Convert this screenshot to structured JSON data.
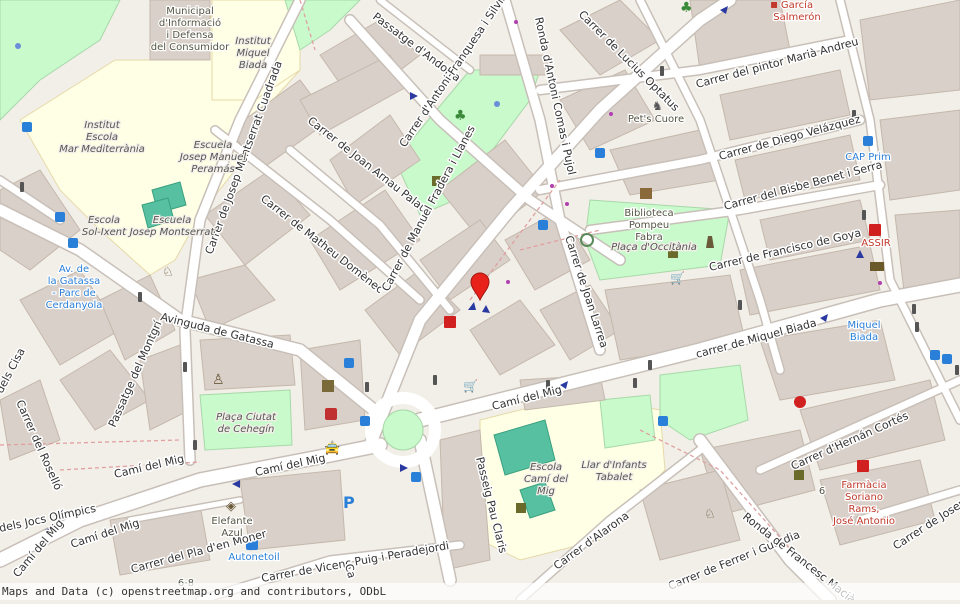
{
  "colors": {
    "background": "#f2efe9",
    "building": "#d9d0c9",
    "school": "#ffffe5",
    "park": "#c8facc",
    "road": "#ffffff",
    "road_outline": "#bbbbbb",
    "marker": "#e8221a",
    "transit_blue": "#2a7fd8",
    "health_red": "#c0392b"
  },
  "streets": {
    "andorra": "Passatge d'Andorra",
    "franquesa": "Carrer d'Antoni Franquesa i Silvia",
    "comas": "Ronda d'Antoni Comas i Pujol",
    "optatus": "Carrer de Lucius Optatus",
    "pintor": "Carrer del pintor Marià Andreu",
    "velazquez": "Carrer de Diego Velázquez",
    "benet": "Carrer del Bisbe Benet i Serra",
    "goya": "Carrer de Francisco de Goya",
    "biada": "carrer de Miquel Biada",
    "arnau": "Carrer de Joan Arnau Palau",
    "matheu": "Carrer de Matheu Domènec",
    "fradera": "Carrer de Manuel Fradera i Llanes",
    "larrea": "Carrer de Joan Larrea",
    "montserrat": "Carrer de Josep Montserrat Cuadrada",
    "gatassa": "Avinguda de Gatassa",
    "montgri": "Passatge del Montgrí",
    "rosello": "Carrer del Roselló",
    "cisa": "dels Cisa",
    "jocs": "dels Jocs Olímpics",
    "mig_1": "Camí del Mig",
    "mig_2": "Camí del Mig",
    "mig_3": "Camí del Mig",
    "mig_4": "Camí del Mig",
    "mig_5": "Camí del Mig",
    "pla": "Carrer del Pla d'en Moner",
    "vicenc": "Carrer de Vicenç Puig i Peradejordi",
    "claris": "Passeig Pau Claris",
    "alarona": "Carrer d'Alarona",
    "ferrer": "Carrer de Ferrer i Guàrdia",
    "macia": "Ronda de Francesc Macià",
    "cortes": "Carrer d'Hernán Cortés",
    "josep": "Carrer de Josep",
    "ca": "Ca"
  },
  "pois": {
    "municipal": [
      "Municipal",
      "d'Informació",
      "i Defensa",
      "del Consumidor"
    ],
    "institut_biada": [
      "Institut",
      "Miquel",
      "Biada"
    ],
    "institut_mediterrania": [
      "Institut",
      "Escola",
      "Mar Mediterrània"
    ],
    "escuela_peramas": [
      "Escuela",
      "Josep Manuel",
      "Peramás"
    ],
    "escola_ixent": [
      "Escola",
      "Sol-Ixent"
    ],
    "escuela_montserrat": [
      "Escuela",
      "Josep Montserrat"
    ],
    "bus_gatassa": [
      "Av. de",
      "la Gatassa",
      "- Parc de",
      "Cerdanyola"
    ],
    "biblioteca": [
      "Biblioteca",
      "Pompeu",
      "Fabra"
    ],
    "placa_occitania": "Plaça d'Occitània",
    "pets_cuore": "Pet's Cuore",
    "garcia": [
      "García",
      "Salmerón"
    ],
    "cap_prim": "CAP Prim",
    "assir": "ASSIR",
    "miquel_biada_bus": [
      "Miquel",
      "Biada"
    ],
    "placa_cehegin": [
      "Plaça Ciutat",
      "de Cehegín"
    ],
    "escola_cami": [
      "Escola",
      "Camí del",
      "Mig"
    ],
    "llar_infants": [
      "Llar d'Infants",
      "Tabalet"
    ],
    "farmacia": [
      "Farmàcia",
      "Soriano",
      "Rams,",
      "José Antonio"
    ],
    "elefante": [
      "Elefante",
      "Azul"
    ],
    "autonetoil": "Autonetoil",
    "house_6": "6",
    "house_68": "6-8"
  },
  "attribution": "Maps and Data (c) openstreetmap.org and contributors, ODbL"
}
